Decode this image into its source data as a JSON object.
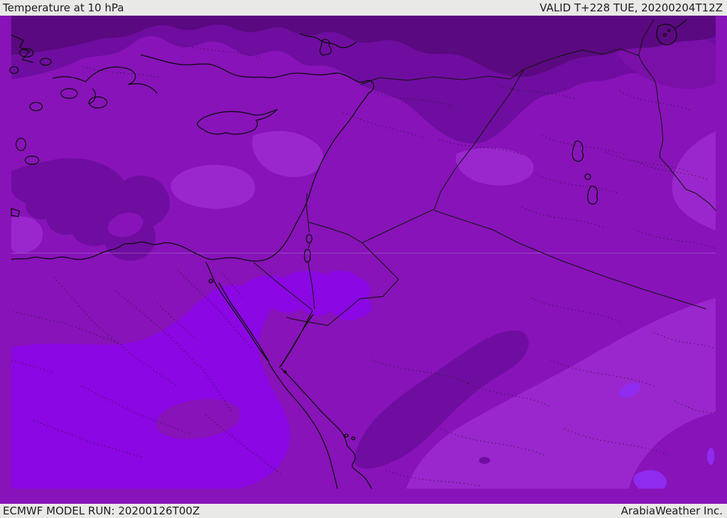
{
  "header": {
    "title": "Temperature at 10 hPa",
    "valid_label": "VALID T+228 TUE, 20200204T12Z"
  },
  "footer": {
    "model_run_label": "ECMWF MODEL RUN: 20200126T00Z",
    "brand": "ArabiaWeather Inc."
  },
  "map": {
    "region": "Middle East / Eastern Mediterranean",
    "field": "Temperature at 10 hPa (shaded contours)",
    "colors": {
      "chrome_bg": "#e9e9e7",
      "chrome_text": "#1c1c1c",
      "darkest": "#5a0980",
      "dark": "#6f0da0",
      "dark_soft": "#7a10a8",
      "medium": "#8813b9",
      "light": "#9a27cd",
      "bright": "#8b07e3",
      "bright2": "#8f2bee",
      "coast": "#0a0a0a",
      "border": "#141414",
      "dotted": "#1f1f1f",
      "grid": "#bb8ed6"
    },
    "shading_levels_order": [
      "darkest",
      "dark",
      "medium",
      "light",
      "bright",
      "bright2"
    ]
  }
}
